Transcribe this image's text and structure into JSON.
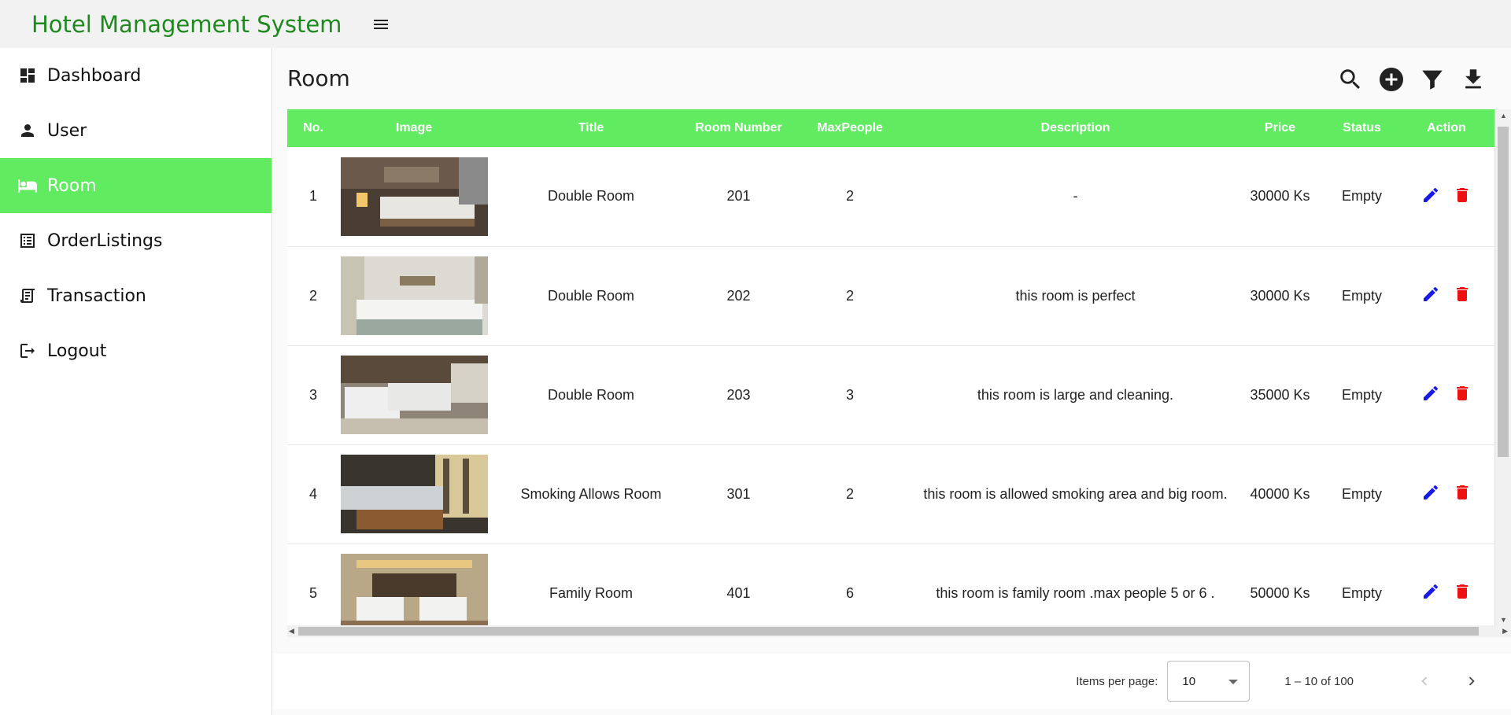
{
  "app": {
    "title": "Hotel Management System"
  },
  "sidebar": {
    "items": [
      {
        "label": "Dashboard",
        "icon": "dashboard-icon"
      },
      {
        "label": "User",
        "icon": "person-icon"
      },
      {
        "label": "Room",
        "icon": "bed-icon",
        "active": true
      },
      {
        "label": "OrderListings",
        "icon": "list-icon"
      },
      {
        "label": "Transaction",
        "icon": "receipt-icon"
      },
      {
        "label": "Logout",
        "icon": "logout-icon"
      }
    ]
  },
  "page": {
    "title": "Room"
  },
  "toolbar": {
    "icons": [
      "search-icon",
      "add-circle-icon",
      "filter-icon",
      "download-icon"
    ]
  },
  "table": {
    "headers": [
      "No.",
      "Image",
      "Title",
      "Room Number",
      "MaxPeople",
      "Description",
      "Price",
      "Status",
      "Action"
    ],
    "rows": [
      {
        "no": "1",
        "title": "Double Room",
        "room_number": "201",
        "max_people": "2",
        "description": "-",
        "price": "30000 Ks",
        "status": "Empty"
      },
      {
        "no": "2",
        "title": "Double Room",
        "room_number": "202",
        "max_people": "2",
        "description": "this room is perfect",
        "price": "30000 Ks",
        "status": "Empty"
      },
      {
        "no": "3",
        "title": "Double Room",
        "room_number": "203",
        "max_people": "3",
        "description": "this room is large and cleaning.",
        "price": "35000 Ks",
        "status": "Empty"
      },
      {
        "no": "4",
        "title": "Smoking Allows Room",
        "room_number": "301",
        "max_people": "2",
        "description": "this room is allowed smoking area and big room.",
        "price": "40000 Ks",
        "status": "Empty"
      },
      {
        "no": "5",
        "title": "Family Room",
        "room_number": "401",
        "max_people": "6",
        "description": "this room is family room .max people 5 or 6 .",
        "price": "50000 Ks",
        "status": "Empty"
      }
    ]
  },
  "paginator": {
    "items_per_page_label": "Items per page:",
    "items_per_page_value": "10",
    "range": "1 – 10 of 100"
  },
  "colors": {
    "accent": "#61eb61",
    "title_green": "#1e8a1e",
    "edit_blue": "#1a1ae6",
    "delete_red": "#ee1111"
  }
}
